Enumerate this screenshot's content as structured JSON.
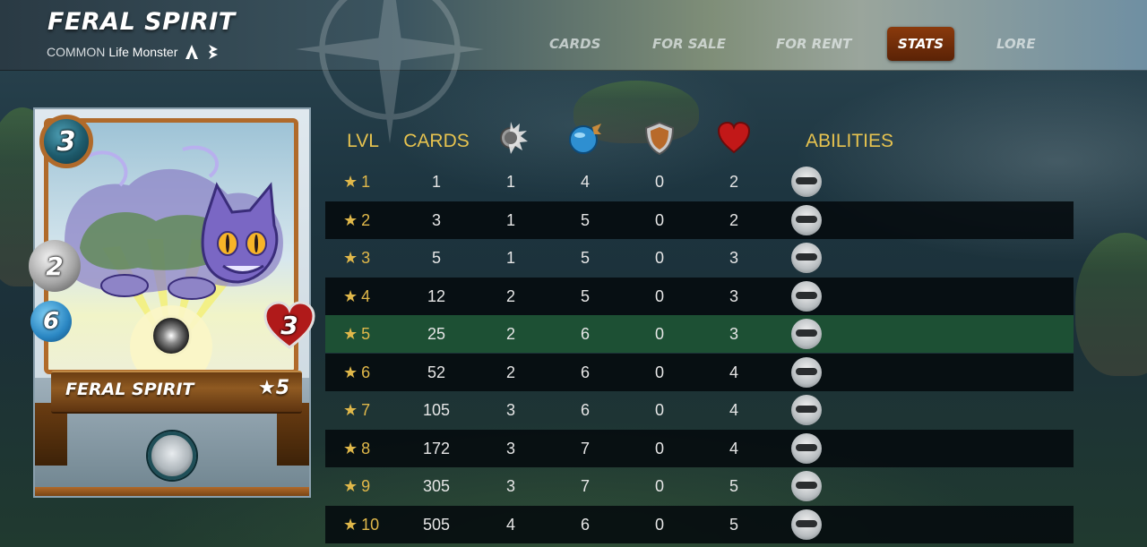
{
  "header": {
    "title": "FERAL SPIRIT",
    "rarity": "COMMON",
    "type": "Life Monster",
    "icons": [
      "element-icon",
      "edition-icon"
    ]
  },
  "nav": {
    "items": [
      {
        "label": "CARDS",
        "active": false
      },
      {
        "label": "FOR SALE",
        "active": false
      },
      {
        "label": "FOR RENT",
        "active": false
      },
      {
        "label": "STATS",
        "active": true
      },
      {
        "label": "LORE",
        "active": false
      }
    ]
  },
  "card": {
    "name": "FERAL SPIRIT",
    "level_label": "★5",
    "mana": "3",
    "melee": "2",
    "speed": "6",
    "health": "3",
    "ability_icon": "dodge-icon"
  },
  "table": {
    "headers": {
      "lvl": "LVL",
      "cards": "CARDS",
      "attack_icon": "melee-attack-icon",
      "speed_icon": "speed-icon",
      "armor_icon": "armor-icon",
      "health_icon": "health-icon",
      "abilities": "ABILITIES"
    },
    "highlight_row": 4,
    "rows": [
      {
        "level": "1",
        "cards": "1",
        "attack": "1",
        "speed": "4",
        "armor": "0",
        "health": "2",
        "ability": "dodge-icon"
      },
      {
        "level": "2",
        "cards": "3",
        "attack": "1",
        "speed": "5",
        "armor": "0",
        "health": "2",
        "ability": "dodge-icon"
      },
      {
        "level": "3",
        "cards": "5",
        "attack": "1",
        "speed": "5",
        "armor": "0",
        "health": "3",
        "ability": "dodge-icon"
      },
      {
        "level": "4",
        "cards": "12",
        "attack": "2",
        "speed": "5",
        "armor": "0",
        "health": "3",
        "ability": "dodge-icon"
      },
      {
        "level": "5",
        "cards": "25",
        "attack": "2",
        "speed": "6",
        "armor": "0",
        "health": "3",
        "ability": "dodge-icon"
      },
      {
        "level": "6",
        "cards": "52",
        "attack": "2",
        "speed": "6",
        "armor": "0",
        "health": "4",
        "ability": "dodge-icon"
      },
      {
        "level": "7",
        "cards": "105",
        "attack": "3",
        "speed": "6",
        "armor": "0",
        "health": "4",
        "ability": "dodge-icon"
      },
      {
        "level": "8",
        "cards": "172",
        "attack": "3",
        "speed": "7",
        "armor": "0",
        "health": "4",
        "ability": "dodge-icon"
      },
      {
        "level": "9",
        "cards": "305",
        "attack": "3",
        "speed": "7",
        "armor": "0",
        "health": "5",
        "ability": "dodge-icon"
      },
      {
        "level": "10",
        "cards": "505",
        "attack": "4",
        "speed": "6",
        "armor": "0",
        "health": "5",
        "ability": "dodge-icon"
      }
    ]
  },
  "colors": {
    "accent_gold": "#e7c34f",
    "active_tab": "#8a3a0c",
    "highlight_row": "#1d5034"
  }
}
